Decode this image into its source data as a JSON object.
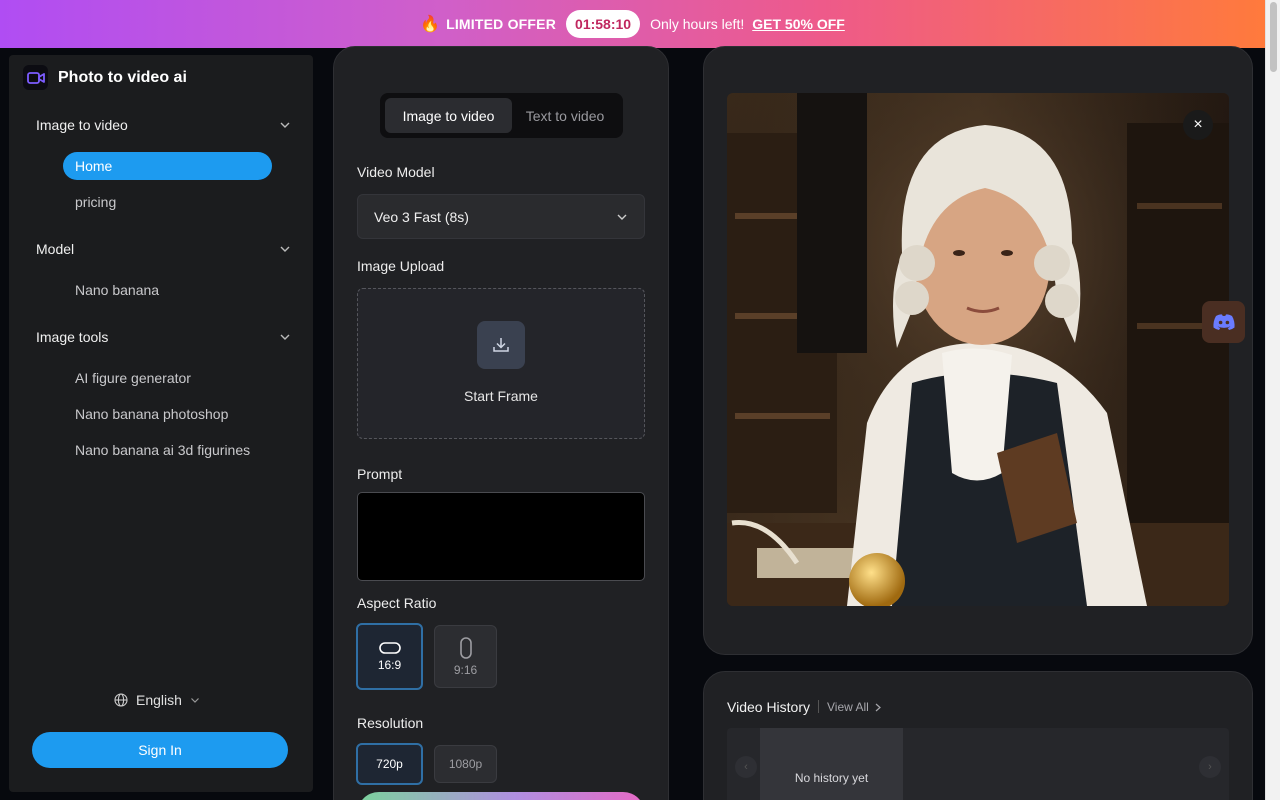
{
  "banner": {
    "fire_icon": "🔥",
    "offer": "LIMITED OFFER",
    "timer": "01:58:10",
    "message": "Only hours left!",
    "cta": "GET 50% OFF"
  },
  "sidebar": {
    "brand": "Photo to video ai",
    "sections": [
      {
        "label": "Image to video",
        "items": [
          "Home",
          "pricing"
        ]
      },
      {
        "label": "Model",
        "items": [
          "Nano banana"
        ]
      },
      {
        "label": "Image tools",
        "items": [
          "AI figure generator",
          "Nano banana photoshop",
          "Nano banana ai 3d figurines"
        ]
      }
    ],
    "active_item": "Home",
    "language": "English",
    "sign_in": "Sign In"
  },
  "form": {
    "tabs": [
      "Image to video",
      "Text to video"
    ],
    "active_tab": "Image to video",
    "video_model_label": "Video Model",
    "video_model_value": "Veo 3 Fast (8s)",
    "image_upload_label": "Image Upload",
    "start_frame": "Start Frame",
    "prompt_label": "Prompt",
    "prompt_value": "",
    "aspect_ratio_label": "Aspect Ratio",
    "aspect_ratios": [
      "16:9",
      "9:16"
    ],
    "selected_aspect_ratio": "16:9",
    "resolution_label": "Resolution",
    "resolutions": [
      "720p",
      "1080p"
    ],
    "selected_resolution": "720p"
  },
  "preview": {
    "close_icon": "×"
  },
  "history": {
    "title": "Video History",
    "view_all": "View All",
    "empty": "No history yet"
  },
  "colors": {
    "accent": "#1d9bf0",
    "panel": "#202124",
    "sidebar": "#1b1c1e"
  }
}
